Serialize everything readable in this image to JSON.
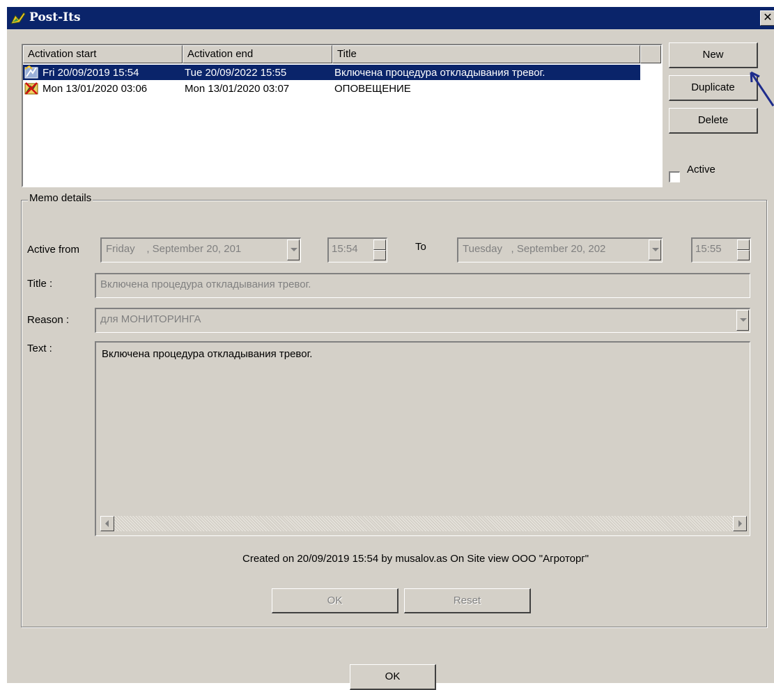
{
  "window": {
    "title": "Post-Its",
    "close_glyph": "✕"
  },
  "list": {
    "columns": [
      "Activation start",
      "Activation end",
      "Title"
    ],
    "rows": [
      {
        "start": "Fri 20/09/2019 15:54",
        "end": "Tue 20/09/2022 15:55",
        "title": "Включена процедура откладывания тревог.",
        "icon": "postit-active-icon",
        "selected": true
      },
      {
        "start": "Mon 13/01/2020 03:06",
        "end": "Mon 13/01/2020 03:07",
        "title": "ОПОВЕЩЕНИЕ",
        "icon": "postit-expired-icon",
        "selected": false
      }
    ]
  },
  "buttons": {
    "new": "New",
    "duplicate": "Duplicate",
    "delete": "Delete",
    "ok": "OK",
    "reset": "Reset",
    "main_ok": "OK"
  },
  "active_checkbox": {
    "label": "Active",
    "checked": false
  },
  "memo": {
    "legend": "Memo details",
    "active_from_label": "Active from",
    "from_date": "Friday    , September 20, 201",
    "from_time": "15:54",
    "to_label": "To",
    "to_date": "Tuesday   , September 20, 202",
    "to_time": "15:55",
    "title_label": "Title :",
    "title_value": "Включена процедура откладывания тревог.",
    "reason_label": "Reason :",
    "reason_value": "для МОНИТОРИНГА",
    "text_label": "Text :",
    "text_value": "Включена процедура откладывания тревог.",
    "created_info": "Created on  20/09/2019 15:54 by musalov.as On Site view ООО \"Агроторг\""
  },
  "colors": {
    "selection": "#0a246a",
    "face": "#d4d0c8",
    "annotation": "#1e2c8c"
  }
}
